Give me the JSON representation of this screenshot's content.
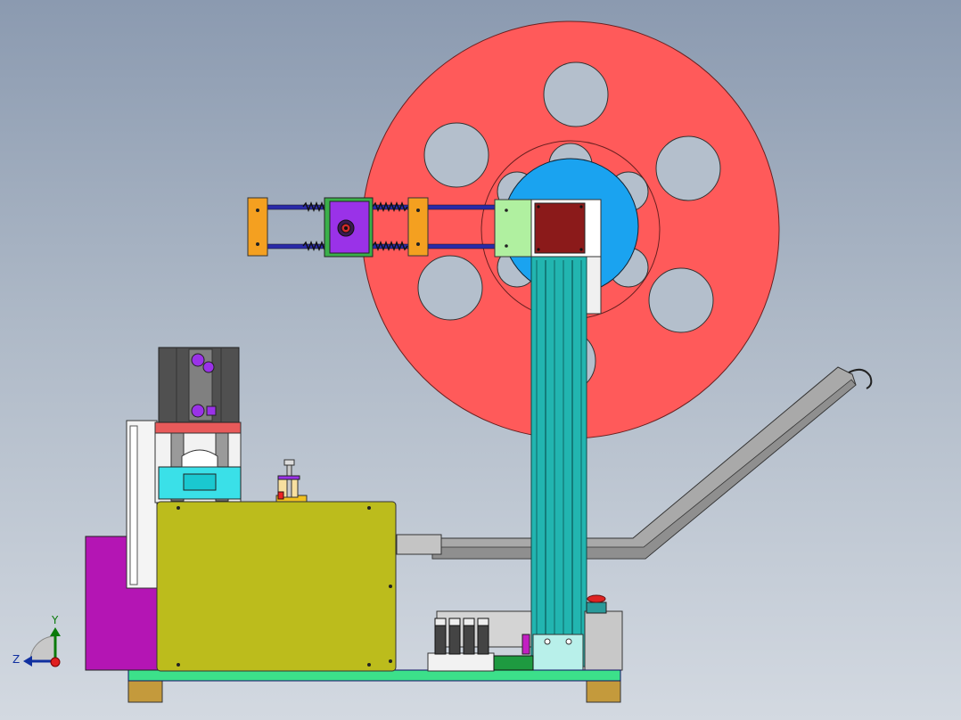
{
  "triad": {
    "y_label": "Y",
    "z_label": "Z"
  },
  "colors": {
    "reel": "#ff5a5a",
    "hub": "#1aa3f0",
    "column": "#22b5b0",
    "base_plate": "#3ce08a",
    "housing": "#bcbc1c",
    "side_panel": "#b415b4",
    "spring": "#2a2aa8",
    "bracket": "#f4a020",
    "carriage": "#9a32e8"
  },
  "reel": {
    "hole_count": 6
  }
}
